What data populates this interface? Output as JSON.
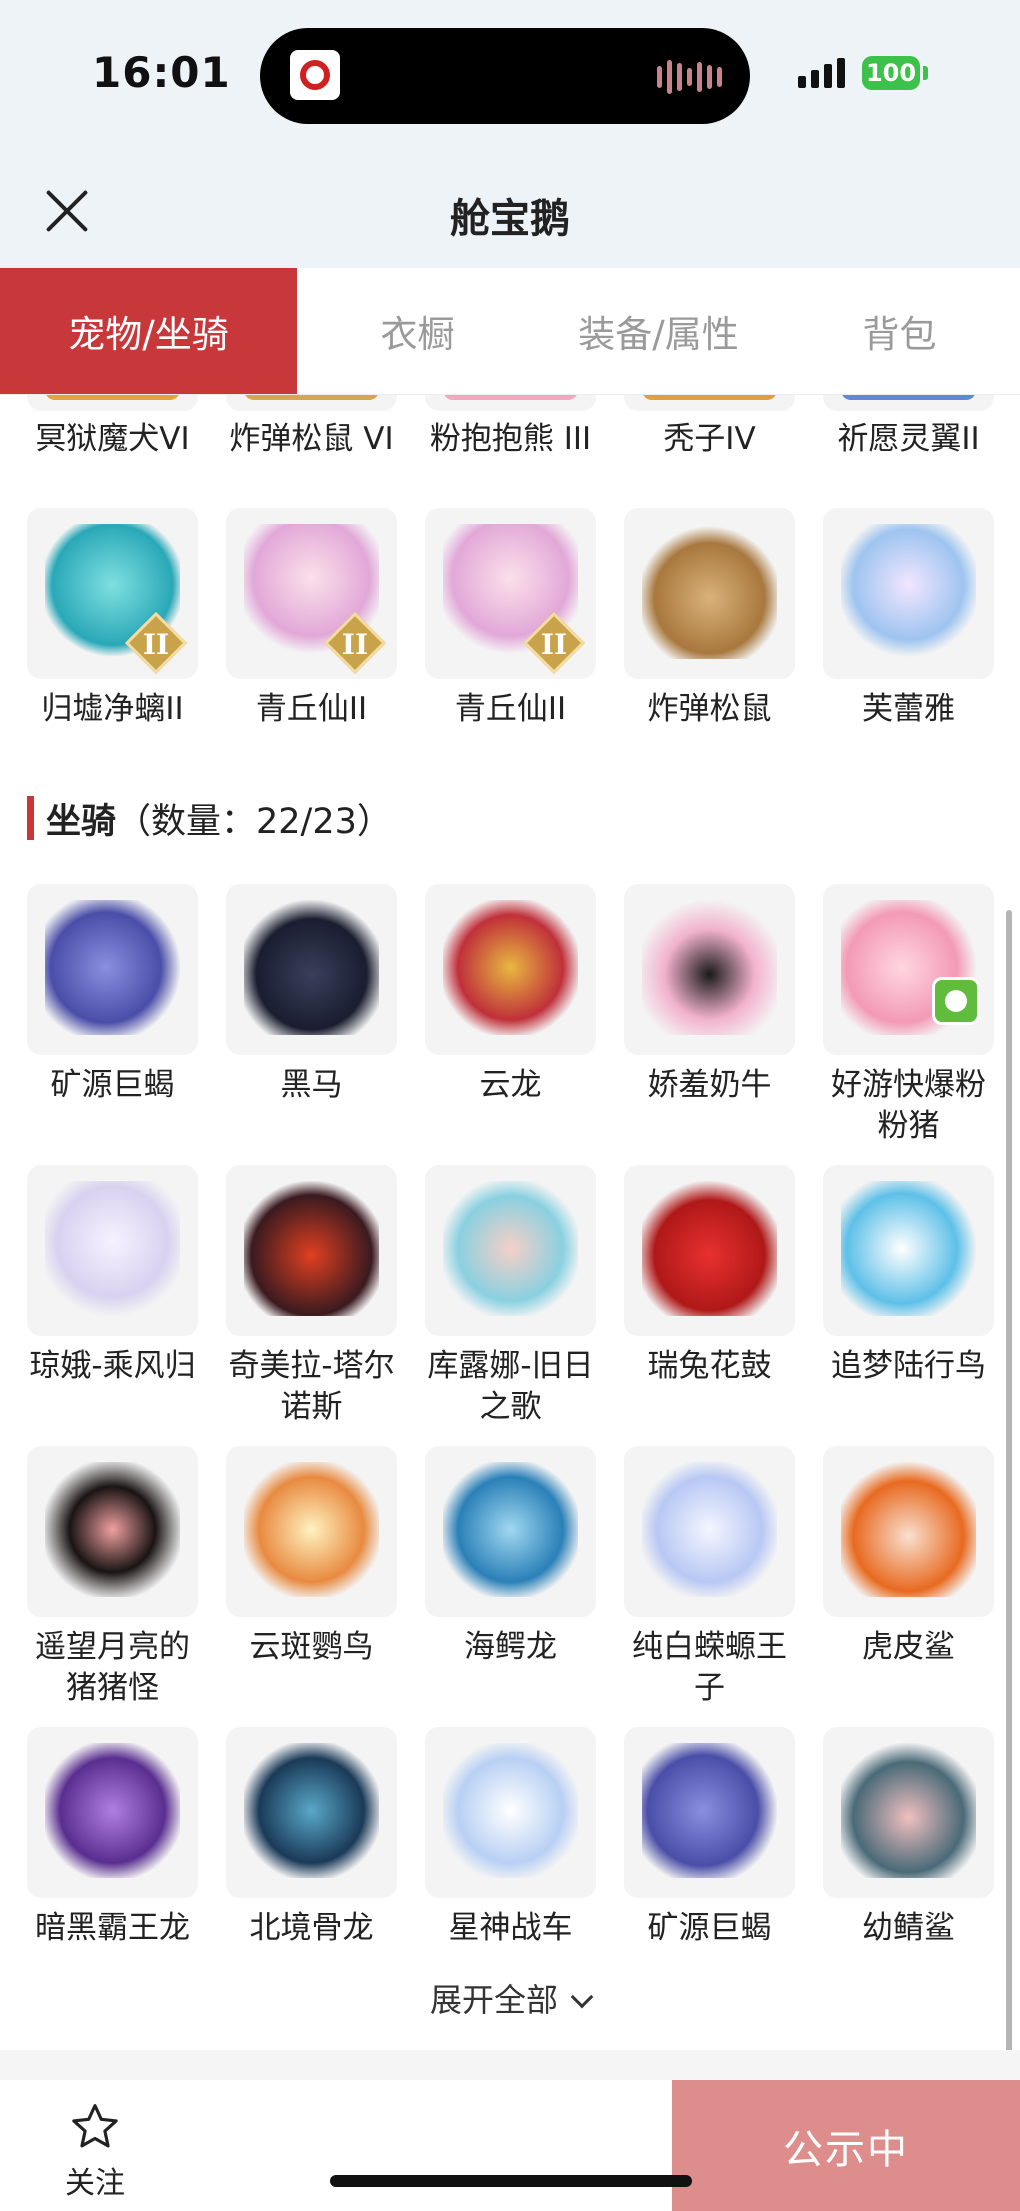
{
  "status": {
    "time": "16:01",
    "battery": "100"
  },
  "nav": {
    "title": "舱宝鹅"
  },
  "tabs": [
    {
      "label": "宠物/坐骑",
      "active": true
    },
    {
      "label": "衣橱",
      "active": false
    },
    {
      "label": "装备/属性",
      "active": false
    },
    {
      "label": "背包",
      "active": false
    }
  ],
  "pets_partial_row": [
    {
      "name": "冥狱魔犬VI"
    },
    {
      "name": "炸弹松鼠 VI"
    },
    {
      "name": "粉抱抱熊 III"
    },
    {
      "name": "秃子IV"
    },
    {
      "name": "祈愿灵翼II"
    }
  ],
  "pets_row": [
    {
      "name": "归墟净螭II",
      "badge": "II"
    },
    {
      "name": "青丘仙II",
      "badge": "II"
    },
    {
      "name": "青丘仙II",
      "badge": "II"
    },
    {
      "name": "炸弹松鼠",
      "badge": ""
    },
    {
      "name": "芙蕾雅",
      "badge": ""
    }
  ],
  "mounts_section": {
    "title": "坐骑",
    "count": "（数量：22/23）"
  },
  "mounts": [
    {
      "name": "矿源巨蝎"
    },
    {
      "name": "黑马"
    },
    {
      "name": "云龙"
    },
    {
      "name": "娇羞奶牛"
    },
    {
      "name": "好游快爆粉粉猪"
    },
    {
      "name": "琼娥-乘风归"
    },
    {
      "name": "奇美拉-塔尔诺斯"
    },
    {
      "name": "库露娜-旧日之歌"
    },
    {
      "name": "瑞兔花鼓"
    },
    {
      "name": "追梦陆行鸟"
    },
    {
      "name": "遥望月亮的猪猪怪"
    },
    {
      "name": "云斑鹦鸟"
    },
    {
      "name": "海鳄龙"
    },
    {
      "name": "纯白蝾螈王子"
    },
    {
      "name": "虎皮鲨"
    },
    {
      "name": "暗黑霸王龙"
    },
    {
      "name": "北境骨龙"
    },
    {
      "name": "星神战车"
    },
    {
      "name": "矿源巨蝎"
    },
    {
      "name": "幼鲭鲨"
    }
  ],
  "expand_label": "展开全部",
  "bottom": {
    "follow_label": "关注",
    "cta_label": "公示中"
  }
}
